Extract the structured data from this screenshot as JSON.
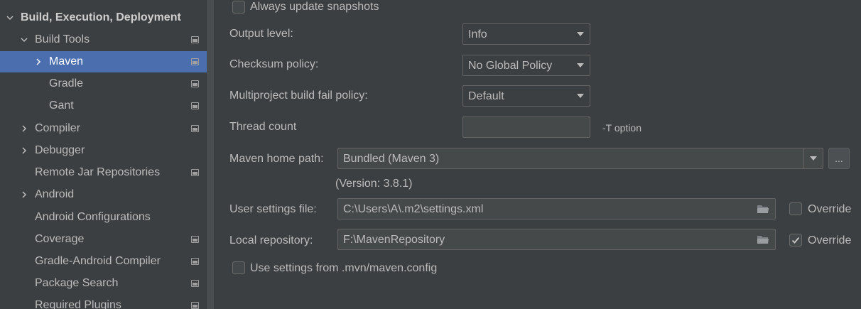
{
  "sidebar": {
    "items": [
      {
        "label": "Build, Execution, Deployment",
        "bold": true,
        "expanded": true,
        "level": 0,
        "has_chevron": true,
        "has_project_icon": false,
        "selected": false
      },
      {
        "label": "Build Tools",
        "expanded": true,
        "level": 1,
        "has_chevron": true,
        "has_project_icon": true,
        "selected": false
      },
      {
        "label": "Maven",
        "expanded": false,
        "level": 2,
        "has_chevron": true,
        "has_project_icon": true,
        "selected": true
      },
      {
        "label": "Gradle",
        "level": 2,
        "has_chevron": false,
        "has_project_icon": true,
        "selected": false
      },
      {
        "label": "Gant",
        "level": 2,
        "has_chevron": false,
        "has_project_icon": true,
        "selected": false
      },
      {
        "label": "Compiler",
        "expanded": false,
        "level": 1,
        "has_chevron": true,
        "has_project_icon": true,
        "selected": false
      },
      {
        "label": "Debugger",
        "expanded": false,
        "level": 1,
        "has_chevron": true,
        "has_project_icon": false,
        "selected": false
      },
      {
        "label": "Remote Jar Repositories",
        "level": 1,
        "has_chevron": false,
        "has_project_icon": true,
        "selected": false
      },
      {
        "label": "Android",
        "expanded": false,
        "level": 1,
        "has_chevron": true,
        "has_project_icon": false,
        "selected": false
      },
      {
        "label": "Android Configurations",
        "level": 1,
        "has_chevron": false,
        "has_project_icon": false,
        "selected": false
      },
      {
        "label": "Coverage",
        "level": 1,
        "has_chevron": false,
        "has_project_icon": true,
        "selected": false
      },
      {
        "label": "Gradle-Android Compiler",
        "level": 1,
        "has_chevron": false,
        "has_project_icon": true,
        "selected": false
      },
      {
        "label": "Package Search",
        "level": 1,
        "has_chevron": false,
        "has_project_icon": true,
        "selected": false
      },
      {
        "label": "Required Plugins",
        "level": 1,
        "has_chevron": false,
        "has_project_icon": true,
        "selected": false
      }
    ]
  },
  "main": {
    "always_update": {
      "label": "Always update snapshots",
      "checked": false
    },
    "output_level": {
      "label": "Output level:",
      "value": "Info"
    },
    "checksum_policy": {
      "label": "Checksum policy:",
      "value": "No Global Policy"
    },
    "multiproject_policy": {
      "label": "Multiproject build fail policy:",
      "value": "Default"
    },
    "thread_count": {
      "label": "Thread count",
      "value": "",
      "hint": "-T option"
    },
    "maven_home": {
      "label": "Maven home path:",
      "value": "Bundled (Maven 3)",
      "browse_label": "...",
      "version": "(Version: 3.8.1)"
    },
    "user_settings": {
      "label": "User settings file:",
      "value": "C:\\Users\\A\\.m2\\settings.xml",
      "override_label": "Override",
      "override_checked": false
    },
    "local_repo": {
      "label": "Local repository:",
      "value": "F:\\MavenRepository",
      "override_label": "Override",
      "override_checked": true
    },
    "use_mvn_config": {
      "label": "Use settings from .mvn/maven.config",
      "checked": false
    }
  },
  "colors": {
    "background": "#3c3f41",
    "selection": "#4b6eaf",
    "text": "#bbbbbb"
  }
}
